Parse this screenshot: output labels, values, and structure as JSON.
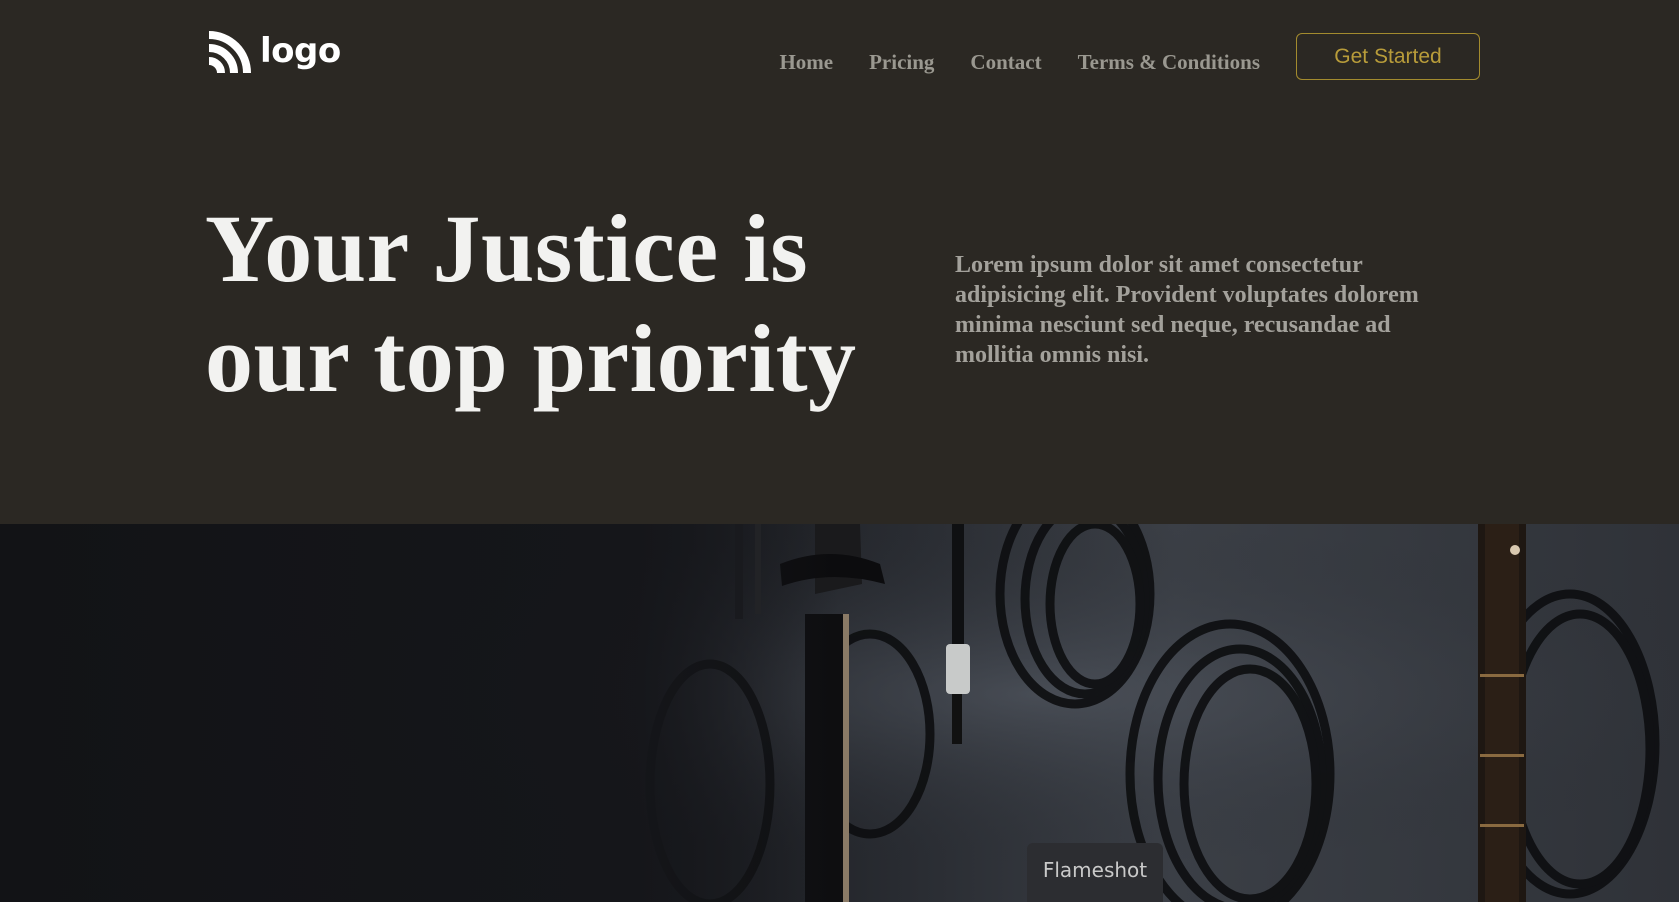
{
  "brand": {
    "logo_text": "logo",
    "logo_icon": "rss-arcs-icon",
    "accent_color": "#a38b2e",
    "background_color": "#2b2823"
  },
  "nav": {
    "items": [
      {
        "label": "Home"
      },
      {
        "label": "Pricing"
      },
      {
        "label": "Contact"
      },
      {
        "label": "Terms & Conditions"
      }
    ],
    "cta_label": "Get Started"
  },
  "hero": {
    "title_line1": "Your Justice is",
    "title_line2": "our top priority",
    "description": "Lorem ipsum dolor sit amet consectetur adipisicing elit. Provident voluptates dolorem minima nesciunt sed neque, recusandae ad mollitia omnis nisi."
  },
  "photo": {
    "subject": "guitars and coiled cables hanging on a wall"
  },
  "overlay": {
    "tooltip_label": "Flameshot"
  }
}
